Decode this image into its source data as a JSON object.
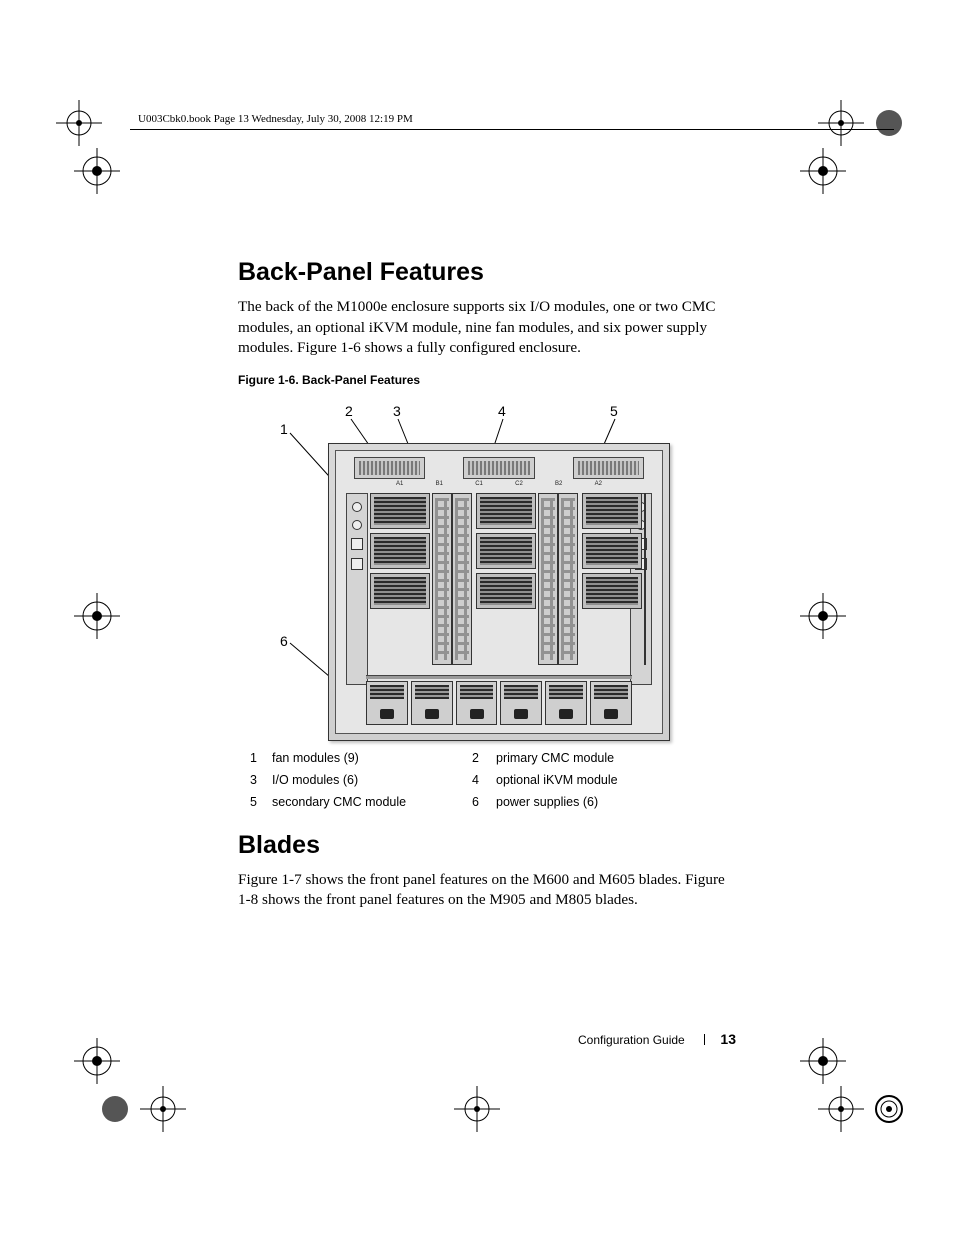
{
  "header": {
    "running_head": "U003Cbk0.book  Page 13  Wednesday, July 30, 2008  12:19 PM"
  },
  "sections": {
    "back_panel": {
      "heading": "Back-Panel Features",
      "para": "The back of the M1000e enclosure supports six I/O modules, one or two CMC modules, an optional iKVM module, nine fan modules, and six power supply modules. Figure 1-6 shows a fully configured enclosure."
    },
    "blades": {
      "heading": "Blades",
      "para": "Figure 1-7 shows the front panel features on the M600 and M605 blades. Figure 1-8 shows the front panel features on the M905 and M805 blades."
    }
  },
  "figure": {
    "caption": "Figure 1-6.    Back-Panel Features",
    "callouts": {
      "c1": "1",
      "c2": "2",
      "c3": "3",
      "c4": "4",
      "c5": "5",
      "c6": "6"
    },
    "slot_labels": [
      "A1",
      "B1",
      "C1",
      "C2",
      "B2",
      "A2"
    ]
  },
  "legend": [
    {
      "n": "1",
      "t": "fan modules (9)"
    },
    {
      "n": "2",
      "t": "primary CMC module"
    },
    {
      "n": "3",
      "t": "I/O modules (6)"
    },
    {
      "n": "4",
      "t": "optional iKVM module"
    },
    {
      "n": "5",
      "t": "secondary CMC module"
    },
    {
      "n": "6",
      "t": "power supplies (6)"
    }
  ],
  "footer": {
    "doc_title": "Configuration Guide",
    "page_number": "13"
  }
}
